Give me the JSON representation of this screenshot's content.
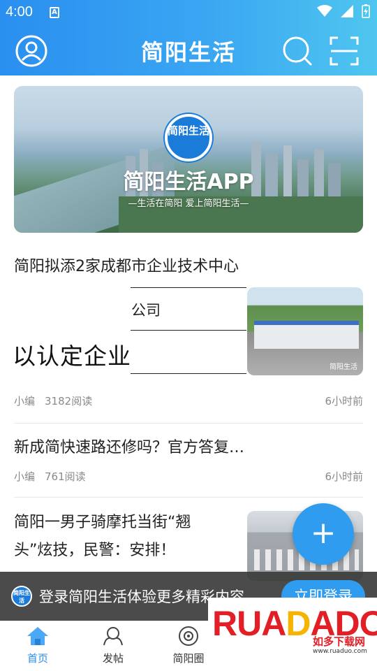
{
  "status_bar": {
    "time": "4:00",
    "notification_icon": "a-letter-icon",
    "right_icons": [
      "wifi-icon",
      "signal-icon",
      "battery-charging-icon"
    ]
  },
  "header": {
    "title": "简阳生活",
    "left_icon": "user-icon",
    "right_icons": [
      "search-icon",
      "scan-icon"
    ]
  },
  "banner": {
    "logo_text": "简阳生活",
    "title": "简阳生活APP",
    "subtitle": "—生活在简阳 爱上简阳生活—"
  },
  "feed": [
    {
      "title": "简阳拟添2家成都市企业技术中心",
      "overlay_text": "公司",
      "fragment_text": "以认定企业",
      "author": "小编",
      "reads": "3182阅读",
      "time": "6小时前",
      "thumbnail_watermark": "简阳生活"
    },
    {
      "title": "新成简快速路还修吗？官方答复…",
      "author": "小编",
      "reads": "761阅读",
      "time": "6小时前"
    },
    {
      "title_line1": "简阳一男子骑摩托当街“翘",
      "title_line2": "头”炫技，民警：安排！"
    }
  ],
  "fab": {
    "label": "+"
  },
  "login_prompt": {
    "logo_text": "简阳生活",
    "text": "登录简阳生活体验更多精彩内容",
    "button": "立即登录"
  },
  "bottom_nav": [
    {
      "label": "首页",
      "icon": "home-icon",
      "active": true
    },
    {
      "label": "发帖",
      "icon": "post-icon",
      "active": false
    },
    {
      "label": "简阳圈",
      "icon": "circle-icon",
      "active": false
    }
  ],
  "watermark": {
    "brand": "RUANDADO",
    "cn": "如多下载网",
    "url": "www.ruaduo.com"
  },
  "colors": {
    "primary": "#2a8ff0",
    "header_gradient_end": "#4fc6ef",
    "login_bar": "#3c3c3c",
    "brand_red": "#e21f26",
    "brand_yellow": "#f6b400"
  }
}
